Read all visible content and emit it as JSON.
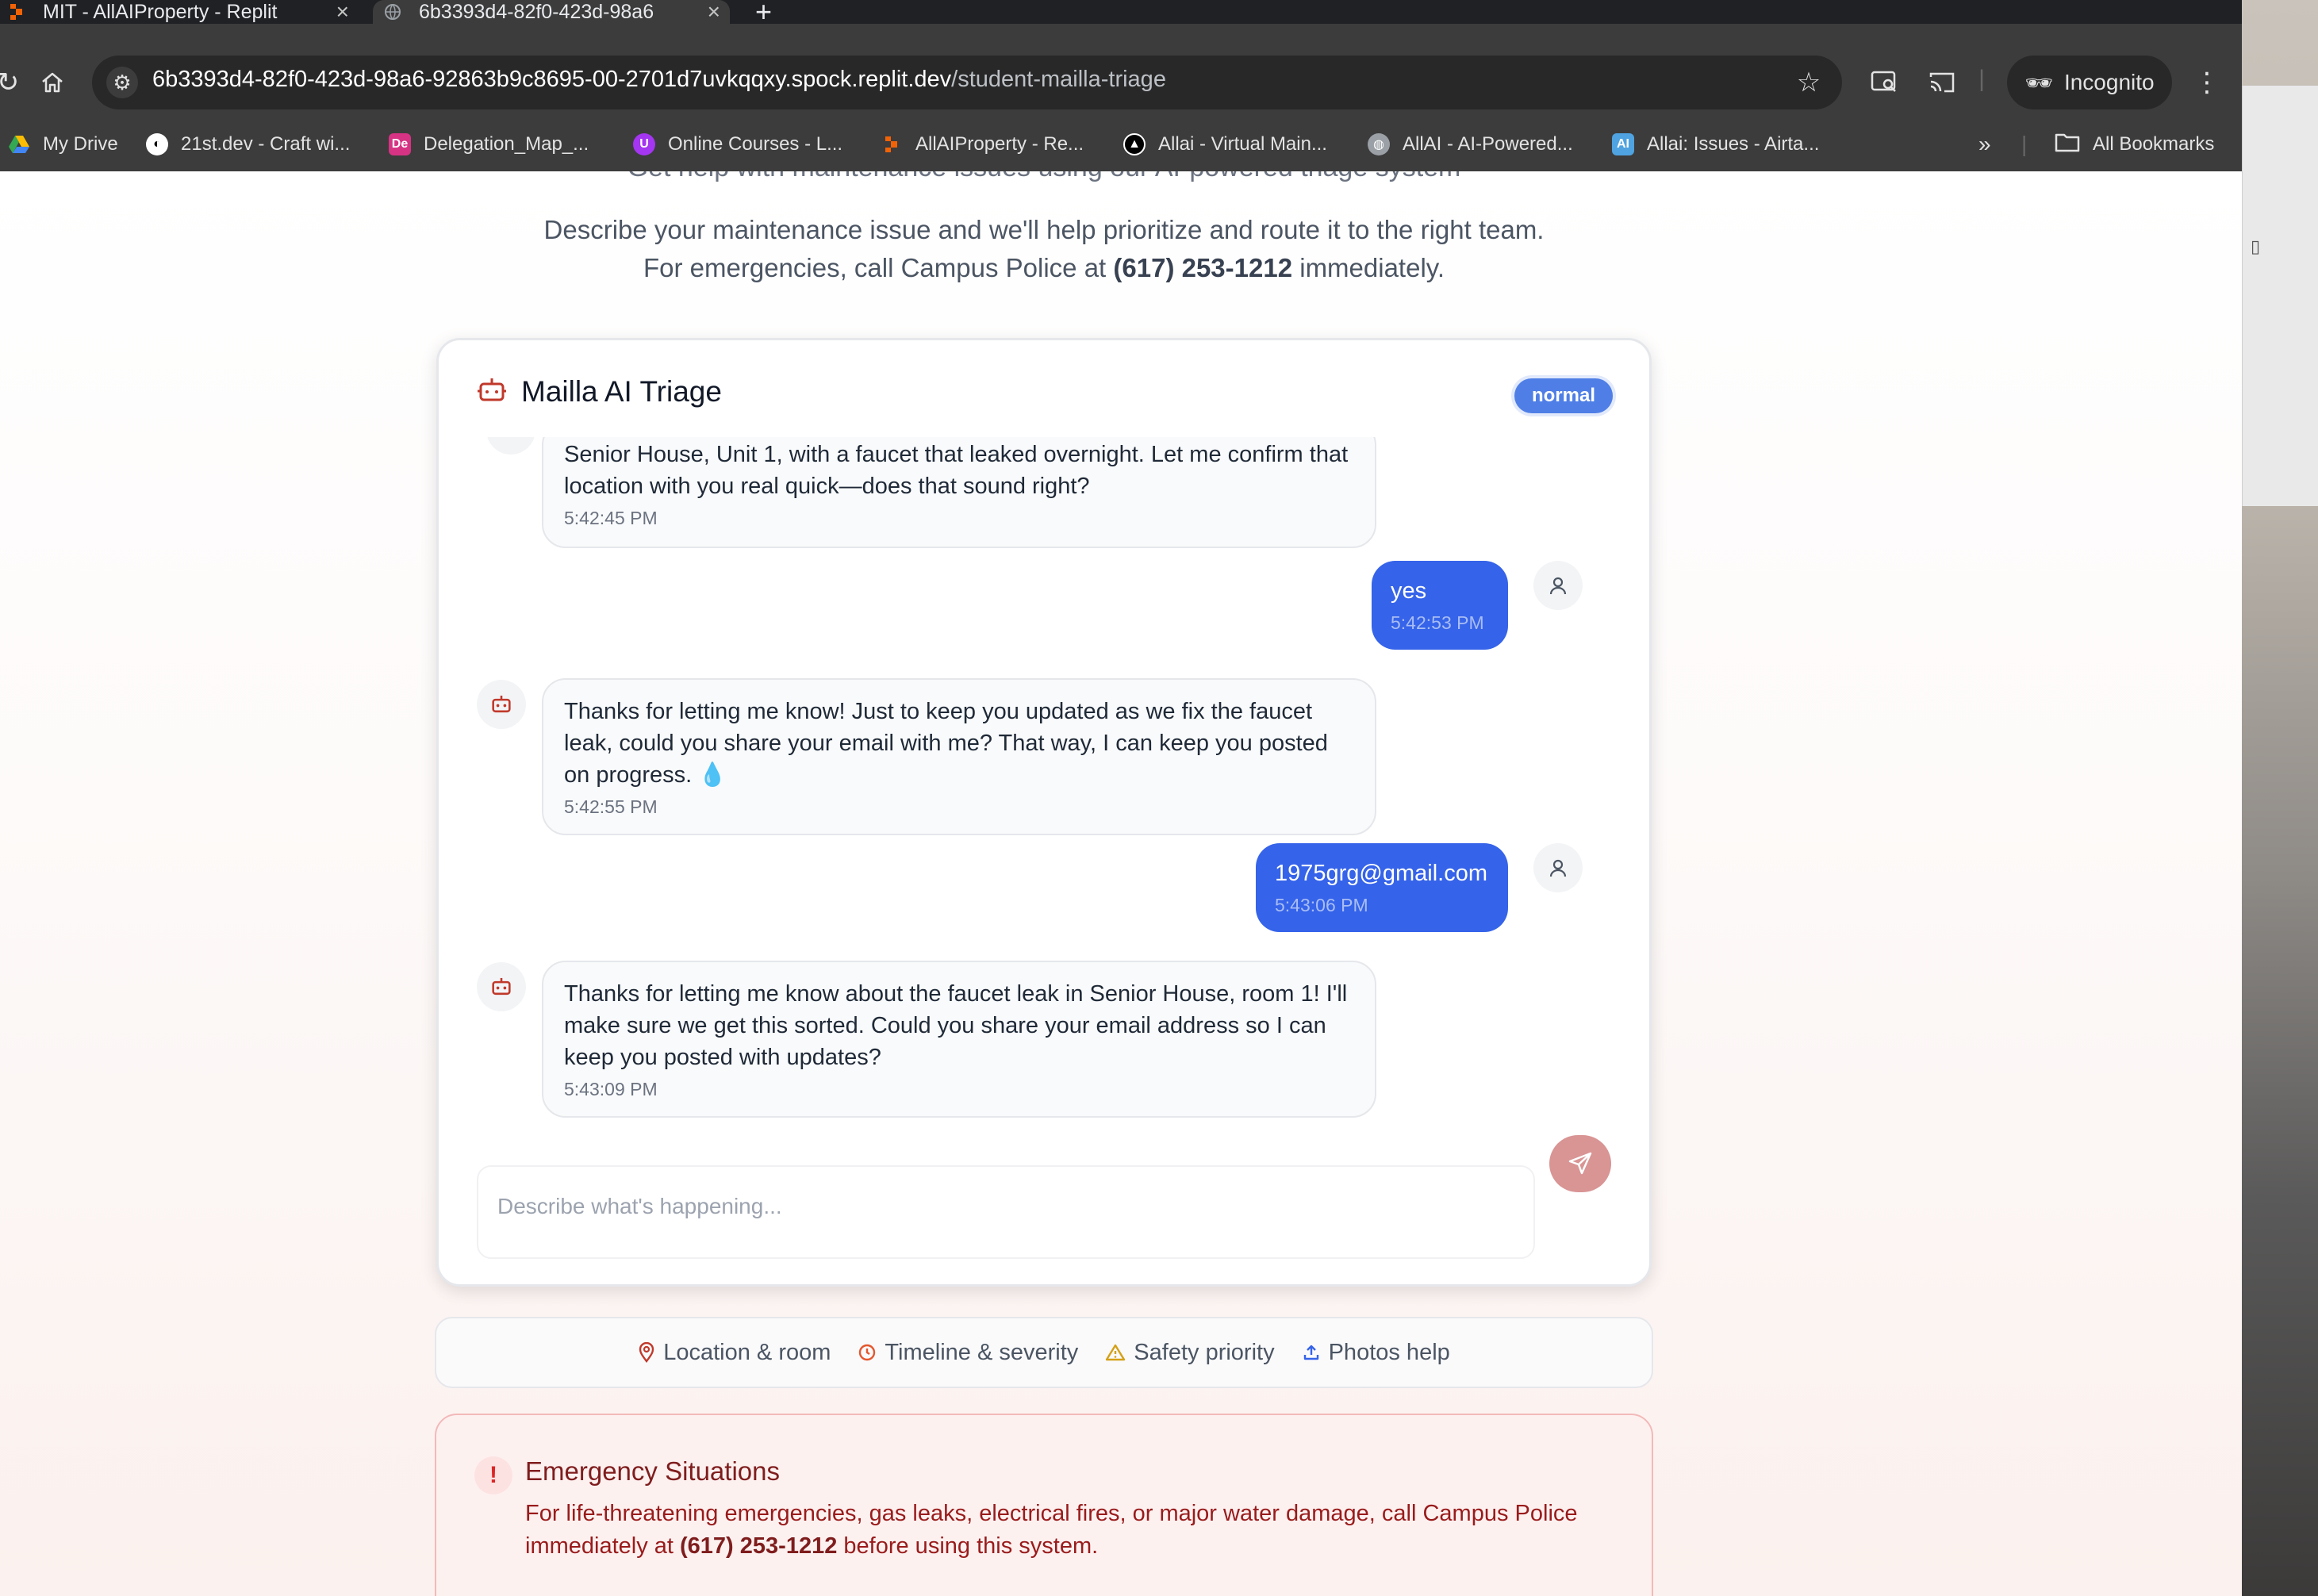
{
  "browser": {
    "tabs": [
      {
        "title": "MIT - AllAIProperty - Replit",
        "favicon": "replit-icon"
      },
      {
        "title": "6b3393d4-82f0-423d-98a6",
        "favicon": "globe-icon"
      }
    ],
    "address": {
      "host": "6b3393d4-82f0-423d-98a6-92863b9c8695-00-2701d7uvkqqxy.spock.replit.dev",
      "path": "/student-mailla-triage"
    },
    "incognito_label": "Incognito",
    "bookmarks": [
      {
        "label": "My Drive",
        "icon": "drive-icon",
        "color": "#34a853"
      },
      {
        "label": "21st.dev - Craft wi...",
        "icon": "21st-icon",
        "color": "#ffffff"
      },
      {
        "label": "Delegation_Map_...",
        "icon": "de-icon",
        "color": "#d63384"
      },
      {
        "label": "Online Courses - L...",
        "icon": "udemy-icon",
        "color": "#a435f0"
      },
      {
        "label": "AllAIProperty - Re...",
        "icon": "replit-icon",
        "color": "#f26207"
      },
      {
        "label": "Allai - Virtual Main...",
        "icon": "triangle-icon",
        "color": "#ffffff"
      },
      {
        "label": "AllAI - AI-Powered...",
        "icon": "globe-icon",
        "color": "#9aa0a6"
      },
      {
        "label": "Allai: Issues - Airta...",
        "icon": "ai-icon",
        "color": "#4fa3e0"
      }
    ],
    "all_bookmarks_label": "All Bookmarks"
  },
  "page": {
    "cut_heading": "Get help with maintenance issues using our AI-powered triage system",
    "intro_line1": "Describe your maintenance issue and we'll help prioritize and route it to the right team.",
    "intro_line2_pre": "For emergencies, call Campus Police at ",
    "intro_phone": "(617) 253-1212",
    "intro_line2_post": " immediately."
  },
  "chat": {
    "title": "Mailla AI Triage",
    "priority_badge": "normal",
    "messages": [
      {
        "role": "assistant",
        "text": "Senior House, Unit 1, with a faucet that leaked overnight. Let me confirm that location with you real quick—does that sound right?",
        "time": "5:42:45 PM"
      },
      {
        "role": "user",
        "text": "yes",
        "time": "5:42:53 PM"
      },
      {
        "role": "assistant",
        "text": "Thanks for letting me know! Just to keep you updated as we fix the faucet leak, could you share your email with me? That way, I can keep you posted on progress. 💧",
        "time": "5:42:55 PM"
      },
      {
        "role": "user",
        "text": "1975grg@gmail.com",
        "time": "5:43:06 PM"
      },
      {
        "role": "assistant",
        "text": "Thanks for letting me know about the faucet leak in Senior House, room 1! I'll make sure we get this sorted. Could you share your email address so I can keep you posted with updates?",
        "time": "5:43:09 PM"
      }
    ],
    "input_placeholder": "Describe what's happening...",
    "input_value": ""
  },
  "tips": [
    {
      "label": "Location & room",
      "icon": "map-pin-icon"
    },
    {
      "label": "Timeline & severity",
      "icon": "clock-icon"
    },
    {
      "label": "Safety priority",
      "icon": "warning-triangle-icon"
    },
    {
      "label": "Photos help",
      "icon": "upload-icon"
    }
  ],
  "emergency": {
    "title": "Emergency Situations",
    "text_pre": "For life-threatening emergencies, gas leaks, electrical fires, or major water damage, call Campus Police immediately at ",
    "phone": "(617) 253-1212",
    "text_post": " before using this system."
  },
  "colors": {
    "accent_red": "#c0392b",
    "user_bubble": "#3563e9",
    "badge_blue": "#4f7fe6",
    "send_button": "#d99494"
  }
}
